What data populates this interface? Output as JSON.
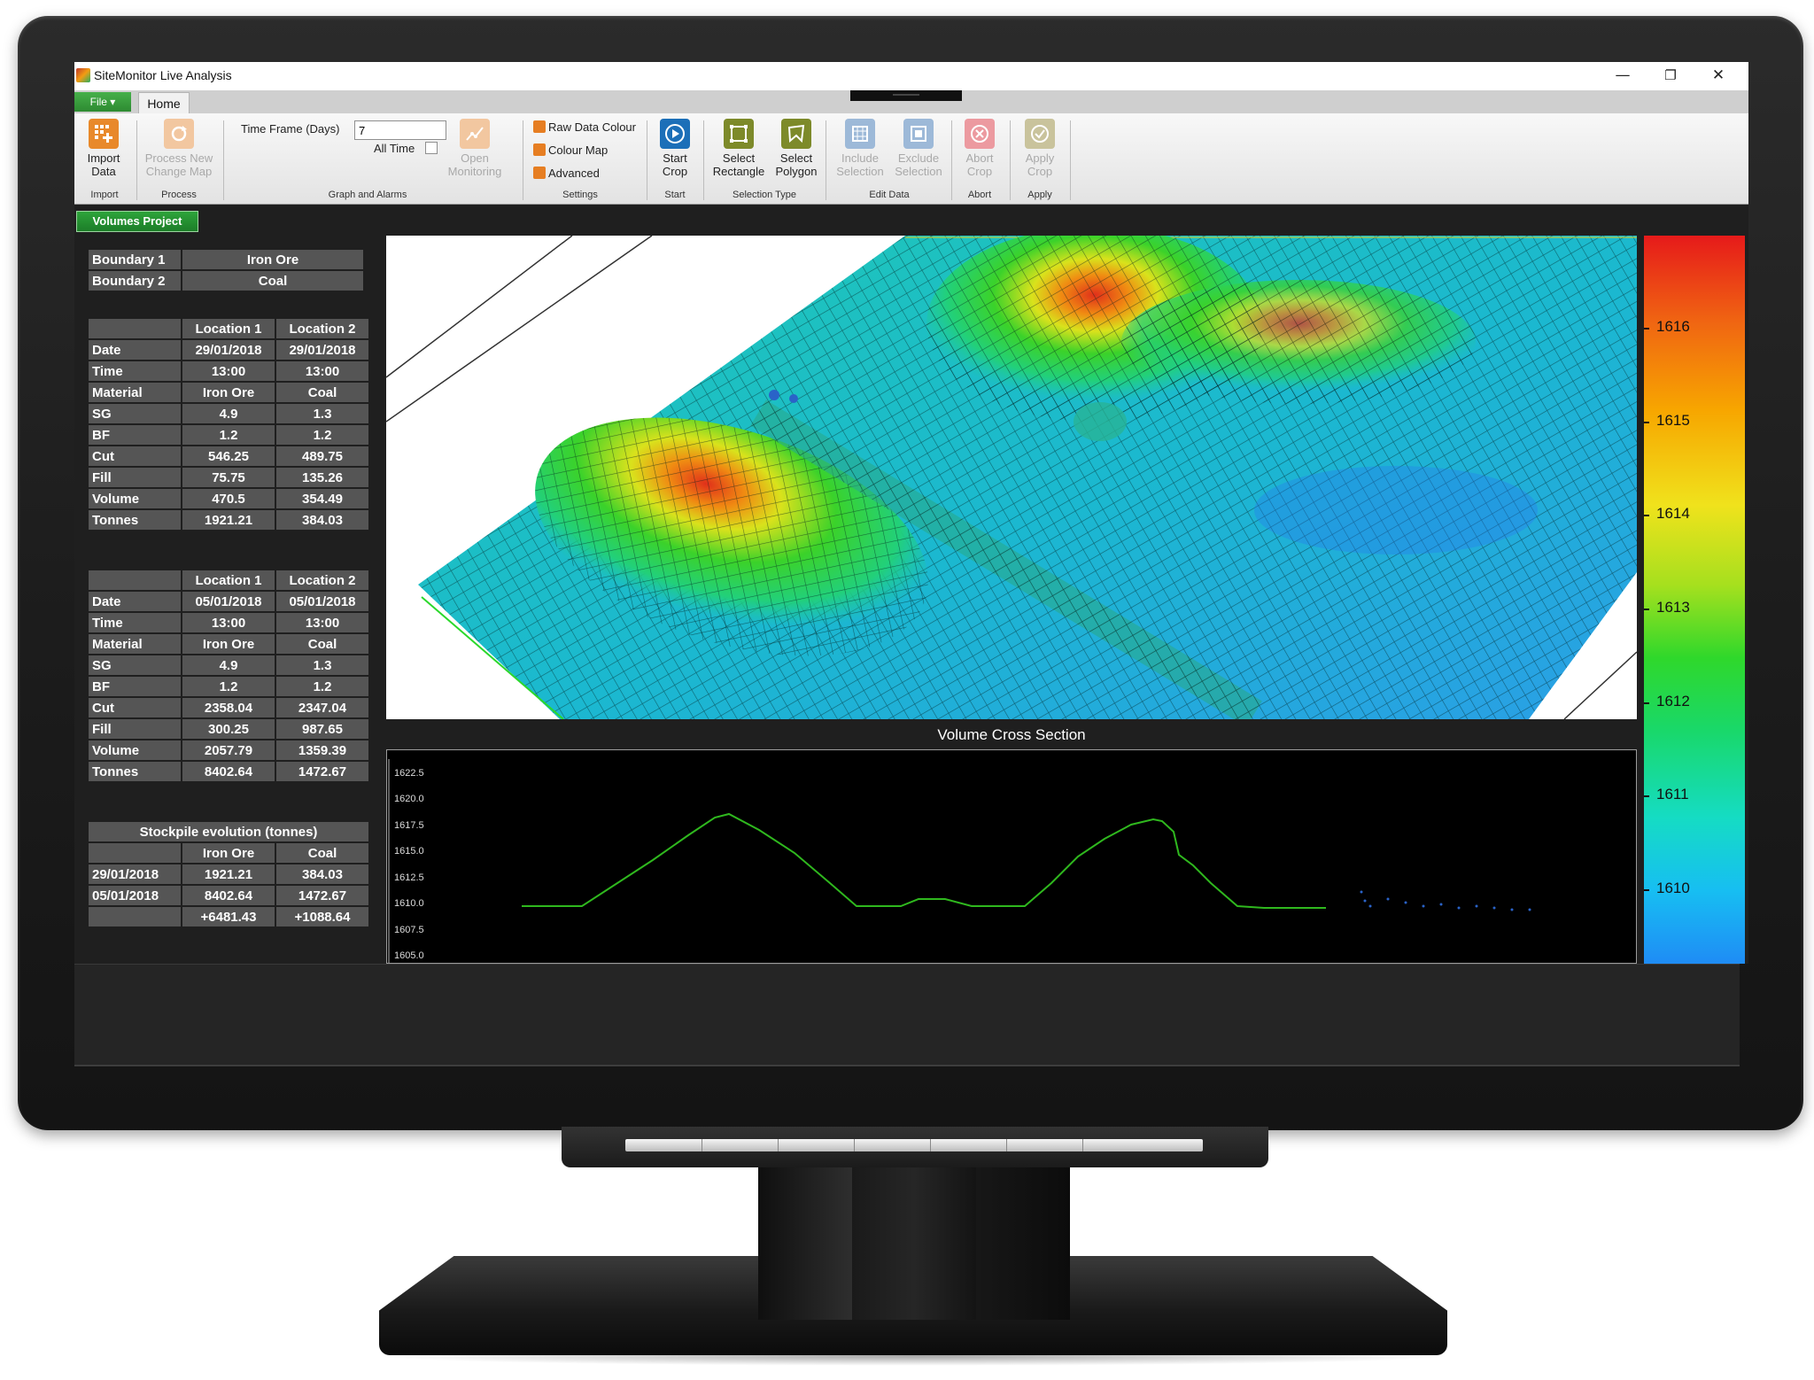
{
  "window": {
    "title": "SiteMonitor Live Analysis",
    "controls": {
      "minimize": "—",
      "restore": "❐",
      "close": "✕"
    }
  },
  "tabs": {
    "file": "File ▾",
    "home": "Home"
  },
  "ribbon": {
    "import": {
      "label1": "Import",
      "label2": "Data",
      "group": "Import"
    },
    "process": {
      "label1": "Process New",
      "label2": "Change Map",
      "group": "Process"
    },
    "graph": {
      "time_frame_label": "Time Frame (Days)",
      "time_frame_value": "7",
      "all_time_label": "All Time",
      "open_label1": "Open",
      "open_label2": "Monitoring",
      "group": "Graph and Alarms"
    },
    "settings": {
      "raw": "Raw Data Colour",
      "colour_map": "Colour Map",
      "advanced": "Advanced",
      "group": "Settings"
    },
    "start": {
      "label1": "Start",
      "label2": "Crop",
      "group": "Start"
    },
    "selection": {
      "rect1": "Select",
      "rect2": "Rectangle",
      "poly1": "Select",
      "poly2": "Polygon",
      "group": "Selection Type"
    },
    "edit": {
      "include1": "Include",
      "include2": "Selection",
      "exclude1": "Exclude",
      "exclude2": "Selection",
      "group": "Edit Data"
    },
    "abort": {
      "label1": "Abort",
      "label2": "Crop",
      "group": "Abort"
    },
    "apply": {
      "label1": "Apply",
      "label2": "Crop",
      "group": "Apply"
    }
  },
  "project_button": "Volumes Project",
  "boundaries": [
    {
      "name": "Boundary 1",
      "value": "Iron Ore"
    },
    {
      "name": "Boundary 2",
      "value": "Coal"
    }
  ],
  "survey1": {
    "headers": [
      "Location 1",
      "Location 2"
    ],
    "rows": [
      {
        "k": "Date",
        "a": "29/01/2018",
        "b": "29/01/2018"
      },
      {
        "k": "Time",
        "a": "13:00",
        "b": "13:00"
      },
      {
        "k": "Material",
        "a": "Iron Ore",
        "b": "Coal"
      },
      {
        "k": "SG",
        "a": "4.9",
        "b": "1.3"
      },
      {
        "k": "BF",
        "a": "1.2",
        "b": "1.2"
      },
      {
        "k": "Cut",
        "a": "546.25",
        "b": "489.75"
      },
      {
        "k": "Fill",
        "a": "75.75",
        "b": "135.26"
      },
      {
        "k": "Volume",
        "a": "470.5",
        "b": "354.49"
      },
      {
        "k": "Tonnes",
        "a": "1921.21",
        "b": "384.03"
      }
    ]
  },
  "survey2": {
    "headers": [
      "Location 1",
      "Location 2"
    ],
    "rows": [
      {
        "k": "Date",
        "a": "05/01/2018",
        "b": "05/01/2018"
      },
      {
        "k": "Time",
        "a": "13:00",
        "b": "13:00"
      },
      {
        "k": "Material",
        "a": "Iron Ore",
        "b": "Coal"
      },
      {
        "k": "SG",
        "a": "4.9",
        "b": "1.3"
      },
      {
        "k": "BF",
        "a": "1.2",
        "b": "1.2"
      },
      {
        "k": "Cut",
        "a": "2358.04",
        "b": "2347.04"
      },
      {
        "k": "Fill",
        "a": "300.25",
        "b": "987.65"
      },
      {
        "k": "Volume",
        "a": "2057.79",
        "b": "1359.39"
      },
      {
        "k": "Tonnes",
        "a": "8402.64",
        "b": "1472.67"
      }
    ]
  },
  "evolution": {
    "title": "Stockpile evolution (tonnes)",
    "headers": [
      "Iron Ore",
      "Coal"
    ],
    "rows": [
      {
        "k": "29/01/2018",
        "a": "1921.21",
        "b": "384.03"
      },
      {
        "k": "05/01/2018",
        "a": "8402.64",
        "b": "1472.67"
      },
      {
        "k": "",
        "a": "+6481.43",
        "b": "+1088.64"
      }
    ]
  },
  "colour_legend": {
    "labels": [
      "1616",
      "1615",
      "1614",
      "1613",
      "1612",
      "1611",
      "1610"
    ],
    "colors": {
      "max": "#e61a1a",
      "mid": "#2fd82b",
      "min": "#1f8cf5"
    }
  },
  "cross_section": {
    "title": "Volume Cross Section",
    "y_ticks": [
      "1622.5",
      "1620.0",
      "1617.5",
      "1615.0",
      "1612.5",
      "1610.0",
      "1607.5",
      "1605.0"
    ],
    "line_color": "#2fb81e"
  }
}
